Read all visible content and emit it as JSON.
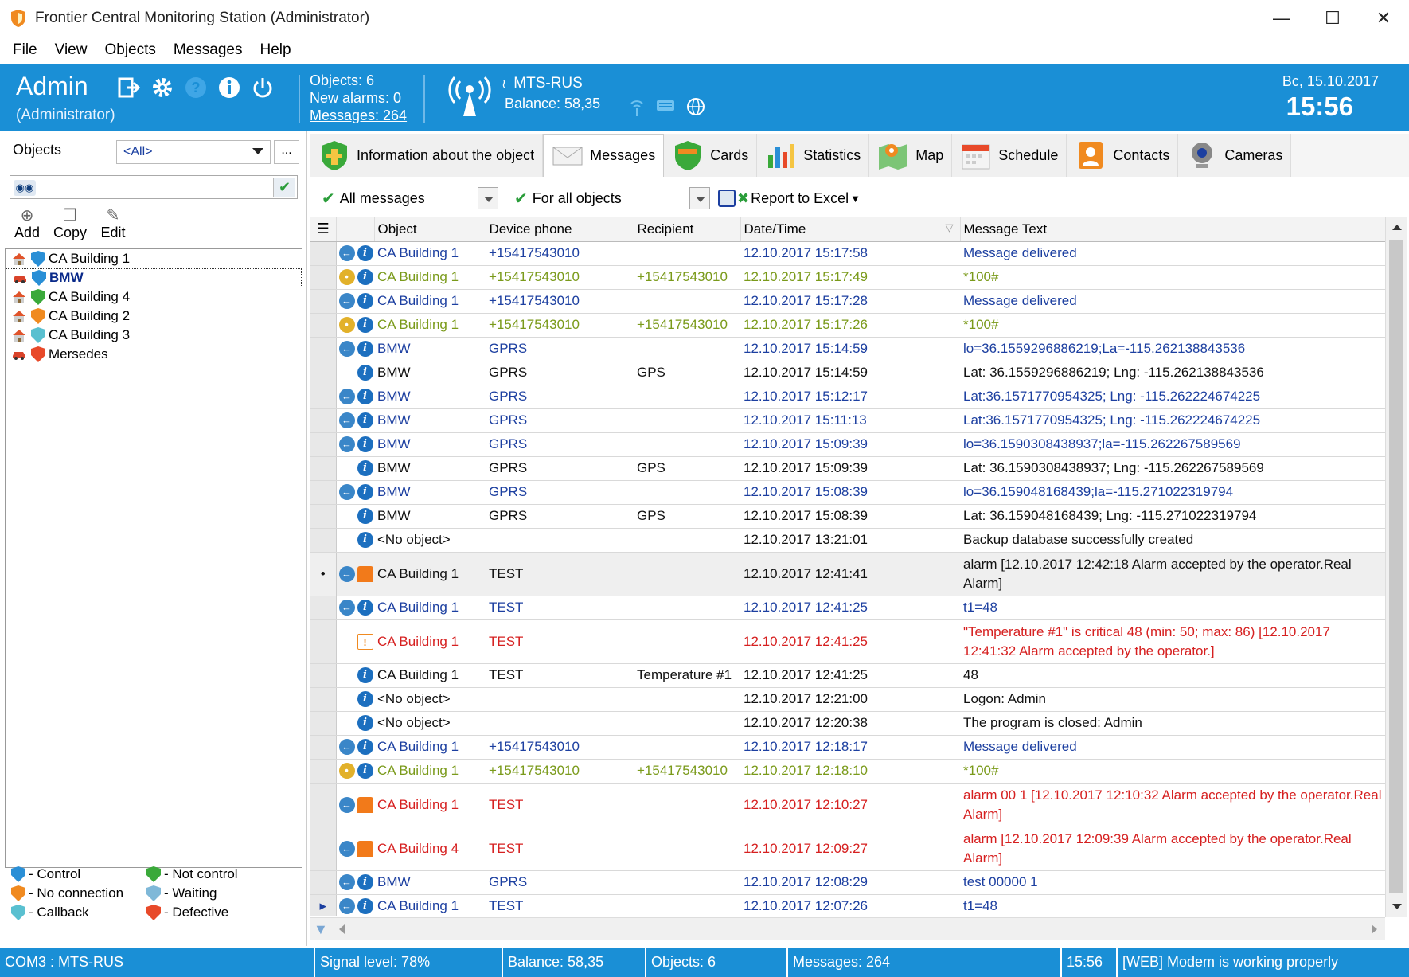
{
  "window": {
    "title": "Frontier Central Monitoring Station (Administrator)"
  },
  "menu": [
    "File",
    "View",
    "Objects",
    "Messages",
    "Help"
  ],
  "header": {
    "user": "Admin",
    "role": "(Administrator)",
    "objects": "Objects:  6",
    "new_alarms": "New alarms: 0",
    "messages": "Messages:  264",
    "operator": "MTS-RUS",
    "balance": "Balance:  58,35",
    "date": "Вс, 15.10.2017",
    "time": "15:56"
  },
  "left": {
    "objects_label": "Objects",
    "filter_value": "<All>",
    "more": "...",
    "tools": {
      "add": "Add",
      "copy": "Copy",
      "edit": "Edit"
    },
    "tree": [
      {
        "name": "CA Building 1",
        "kind": "house",
        "status": "control",
        "selected": false
      },
      {
        "name": "BMW",
        "kind": "car",
        "status": "control",
        "selected": true
      },
      {
        "name": "CA Building 4",
        "kind": "house",
        "status": "not-control",
        "selected": false
      },
      {
        "name": "CA Building 2",
        "kind": "house",
        "status": "no-connection",
        "selected": false
      },
      {
        "name": "CA Building 3",
        "kind": "house",
        "status": "callback",
        "selected": false
      },
      {
        "name": "Mersedes",
        "kind": "car",
        "status": "defective",
        "selected": false
      }
    ],
    "legend": {
      "control": "- Control",
      "not_control": "- Not control",
      "no_connection": "- No connection",
      "waiting": "- Waiting",
      "callback": "- Callback",
      "defective": "- Defective"
    }
  },
  "tabs": [
    {
      "label": "Information about the object",
      "icon": "shield-icon"
    },
    {
      "label": "Messages",
      "icon": "envelope-icon"
    },
    {
      "label": "Cards",
      "icon": "cards-shield-icon"
    },
    {
      "label": "Statistics",
      "icon": "bar-chart-icon"
    },
    {
      "label": "Map",
      "icon": "map-pin-icon"
    },
    {
      "label": "Schedule",
      "icon": "calendar-icon"
    },
    {
      "label": "Contacts",
      "icon": "contact-card-icon"
    },
    {
      "label": "Cameras",
      "icon": "webcam-icon"
    }
  ],
  "filters": {
    "messages": "All messages",
    "objects": "For all objects",
    "report": "Report to Excel"
  },
  "grid": {
    "columns": [
      "Object",
      "Device phone",
      "Recipient",
      "Date/Time",
      "Message Text"
    ],
    "rows": [
      {
        "icons": [
          "back",
          "info"
        ],
        "object": "CA Building 1",
        "phone": "+15417543010",
        "recipient": "",
        "datetime": "12.10.2017 15:17:58",
        "text": "Message delivered",
        "color": "blue"
      },
      {
        "icons": [
          "pend",
          "info"
        ],
        "object": "CA Building 1",
        "phone": "+15417543010",
        "recipient": "+15417543010",
        "datetime": "12.10.2017 15:17:49",
        "text": "*100#",
        "color": "olive"
      },
      {
        "icons": [
          "back",
          "info"
        ],
        "object": "CA Building 1",
        "phone": "+15417543010",
        "recipient": "",
        "datetime": "12.10.2017 15:17:28",
        "text": "Message delivered",
        "color": "blue"
      },
      {
        "icons": [
          "pend",
          "info"
        ],
        "object": "CA Building 1",
        "phone": "+15417543010",
        "recipient": "+15417543010",
        "datetime": "12.10.2017 15:17:26",
        "text": "*100#",
        "color": "olive"
      },
      {
        "icons": [
          "back",
          "info"
        ],
        "object": "BMW",
        "phone": "GPRS",
        "recipient": "",
        "datetime": "12.10.2017 15:14:59",
        "text": "lo=36.1559296886219;La=-115.262138843536",
        "color": "blue"
      },
      {
        "icons": [
          "none",
          "info"
        ],
        "object": "BMW",
        "phone": "GPRS",
        "recipient": "GPS",
        "datetime": "12.10.2017 15:14:59",
        "text": "Lat: 36.1559296886219; Lng: -115.262138843536",
        "color": "black"
      },
      {
        "icons": [
          "back",
          "info"
        ],
        "object": "BMW",
        "phone": "GPRS",
        "recipient": "",
        "datetime": "12.10.2017 15:12:17",
        "text": "Lat:36.1571770954325; Lng: -115.262224674225",
        "color": "blue"
      },
      {
        "icons": [
          "back",
          "info"
        ],
        "object": "BMW",
        "phone": "GPRS",
        "recipient": "",
        "datetime": "12.10.2017 15:11:13",
        "text": "Lat:36.1571770954325; Lng: -115.262224674225",
        "color": "blue"
      },
      {
        "icons": [
          "back",
          "info"
        ],
        "object": "BMW",
        "phone": "GPRS",
        "recipient": "",
        "datetime": "12.10.2017 15:09:39",
        "text": "lo=36.1590308438937;la=-115.262267589569",
        "color": "blue"
      },
      {
        "icons": [
          "none",
          "info"
        ],
        "object": "BMW",
        "phone": "GPRS",
        "recipient": "GPS",
        "datetime": "12.10.2017 15:09:39",
        "text": "Lat: 36.1590308438937; Lng: -115.262267589569",
        "color": "black"
      },
      {
        "icons": [
          "back",
          "info"
        ],
        "object": "BMW",
        "phone": "GPRS",
        "recipient": "",
        "datetime": "12.10.2017 15:08:39",
        "text": "lo=36.159048168439;la=-115.271022319794",
        "color": "blue"
      },
      {
        "icons": [
          "none",
          "info"
        ],
        "object": "BMW",
        "phone": "GPRS",
        "recipient": "GPS",
        "datetime": "12.10.2017 15:08:39",
        "text": "Lat: 36.159048168439; Lng: -115.271022319794",
        "color": "black"
      },
      {
        "icons": [
          "none",
          "info"
        ],
        "object": "<No object>",
        "phone": "",
        "recipient": "",
        "datetime": "12.10.2017 13:21:01",
        "text": "Backup database successfully created",
        "color": "black"
      },
      {
        "icons": [
          "back",
          "alarm"
        ],
        "object": "CA Building 1",
        "phone": "TEST",
        "recipient": "",
        "datetime": "12.10.2017 12:41:41",
        "text": "alarm [12.10.2017 12:42:18 Alarm accepted by the operator.Real Alarm]",
        "color": "black",
        "tall": true,
        "highlight": true,
        "marker": "•"
      },
      {
        "icons": [
          "back",
          "info"
        ],
        "object": "CA Building 1",
        "phone": "TEST",
        "recipient": "",
        "datetime": "12.10.2017 12:41:25",
        "text": "t1=48",
        "color": "blue"
      },
      {
        "icons": [
          "none",
          "warn"
        ],
        "object": "CA Building 1",
        "phone": "TEST",
        "recipient": "",
        "datetime": "12.10.2017 12:41:25",
        "text": "\"Temperature #1\" is critical 48 (min: 50; max: 86) [12.10.2017 12:41:32 Alarm accepted by the operator.]",
        "color": "red",
        "tall": true
      },
      {
        "icons": [
          "none",
          "info"
        ],
        "object": "CA Building 1",
        "phone": "TEST",
        "recipient": "Temperature #1",
        "datetime": "12.10.2017 12:41:25",
        "text": "48",
        "color": "black"
      },
      {
        "icons": [
          "none",
          "info"
        ],
        "object": "<No object>",
        "phone": "",
        "recipient": "",
        "datetime": "12.10.2017 12:21:00",
        "text": "Logon: Admin",
        "color": "black"
      },
      {
        "icons": [
          "none",
          "info"
        ],
        "object": "<No object>",
        "phone": "",
        "recipient": "",
        "datetime": "12.10.2017 12:20:38",
        "text": "The program is closed: Admin",
        "color": "black"
      },
      {
        "icons": [
          "back",
          "info"
        ],
        "object": "CA Building 1",
        "phone": "+15417543010",
        "recipient": "",
        "datetime": "12.10.2017 12:18:17",
        "text": "Message delivered",
        "color": "blue"
      },
      {
        "icons": [
          "pend",
          "info"
        ],
        "object": "CA Building 1",
        "phone": "+15417543010",
        "recipient": "+15417543010",
        "datetime": "12.10.2017 12:18:10",
        "text": "*100#",
        "color": "olive"
      },
      {
        "icons": [
          "back",
          "alarm"
        ],
        "object": "CA Building 1",
        "phone": "TEST",
        "recipient": "",
        "datetime": "12.10.2017 12:10:27",
        "text": "alarm 00 1 [12.10.2017 12:10:32 Alarm accepted by the operator.Real Alarm]",
        "color": "red",
        "tall": true
      },
      {
        "icons": [
          "back",
          "alarm"
        ],
        "object": "CA Building 4",
        "phone": "TEST",
        "recipient": "",
        "datetime": "12.10.2017 12:09:27",
        "text": "alarm [12.10.2017 12:09:39 Alarm accepted by the operator.Real Alarm]",
        "color": "red",
        "tall": true
      },
      {
        "icons": [
          "back",
          "info"
        ],
        "object": "BMW",
        "phone": "GPRS",
        "recipient": "",
        "datetime": "12.10.2017 12:08:29",
        "text": "test 00000 1",
        "color": "blue"
      },
      {
        "icons": [
          "back",
          "info"
        ],
        "object": "CA Building 1",
        "phone": "TEST",
        "recipient": "",
        "datetime": "12.10.2017 12:07:26",
        "text": "t1=48",
        "color": "blue",
        "marker": "▸"
      }
    ]
  },
  "status": {
    "port": "COM3 :  MTS-RUS",
    "signal": "Signal level:  78%",
    "balance": "Balance:  58,35",
    "objects": "Objects:  6",
    "messages": "Messages:  264",
    "time": "15:56",
    "modem": "[WEB] Modem is working properly"
  },
  "colors": {
    "accent": "#1a8fd6",
    "blue_text": "#1c3fa0",
    "olive_text": "#7a9a1a",
    "red_text": "#d62020",
    "control": "#2a8fd6",
    "not_control": "#3aa93a",
    "no_connection": "#f08a20",
    "waiting": "#7fb8d8",
    "callback": "#5ac0d0",
    "defective": "#e84a2a"
  }
}
